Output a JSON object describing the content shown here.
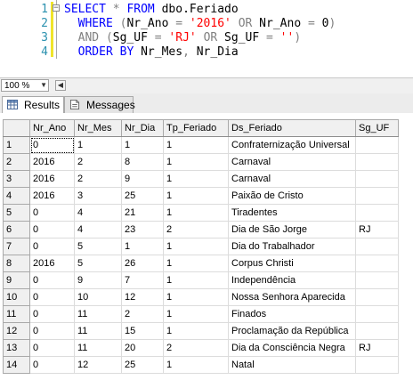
{
  "editor": {
    "lines": [
      {
        "num": "1",
        "tokens": [
          {
            "t": "SELECT",
            "c": "kw"
          },
          {
            "t": " ",
            "c": "txt"
          },
          {
            "t": "*",
            "c": "op"
          },
          {
            "t": " ",
            "c": "txt"
          },
          {
            "t": "FROM",
            "c": "kw"
          },
          {
            "t": " dbo.Feriado",
            "c": "txt"
          }
        ]
      },
      {
        "num": "2",
        "tokens": [
          {
            "t": "  WHERE",
            "c": "kw"
          },
          {
            "t": " ",
            "c": "txt"
          },
          {
            "t": "(",
            "c": "op"
          },
          {
            "t": "Nr_Ano",
            "c": "txt"
          },
          {
            "t": " = ",
            "c": "op"
          },
          {
            "t": "'2016'",
            "c": "str"
          },
          {
            "t": " ",
            "c": "txt"
          },
          {
            "t": "OR",
            "c": "op"
          },
          {
            "t": " Nr_Ano ",
            "c": "txt"
          },
          {
            "t": "=",
            "c": "op"
          },
          {
            "t": " 0",
            "c": "txt"
          },
          {
            "t": ")",
            "c": "op"
          }
        ]
      },
      {
        "num": "3",
        "tokens": [
          {
            "t": "  AND",
            "c": "op"
          },
          {
            "t": " ",
            "c": "txt"
          },
          {
            "t": "(",
            "c": "op"
          },
          {
            "t": "Sg_UF",
            "c": "txt"
          },
          {
            "t": " = ",
            "c": "op"
          },
          {
            "t": "'RJ'",
            "c": "str"
          },
          {
            "t": " ",
            "c": "txt"
          },
          {
            "t": "OR",
            "c": "op"
          },
          {
            "t": " Sg_UF ",
            "c": "txt"
          },
          {
            "t": "=",
            "c": "op"
          },
          {
            "t": " ",
            "c": "txt"
          },
          {
            "t": "''",
            "c": "str"
          },
          {
            "t": ")",
            "c": "op"
          }
        ]
      },
      {
        "num": "4",
        "tokens": [
          {
            "t": "  ORDER BY",
            "c": "kw"
          },
          {
            "t": " Nr_Mes",
            "c": "txt"
          },
          {
            "t": ",",
            "c": "op"
          },
          {
            "t": " Nr_Dia",
            "c": "txt"
          }
        ]
      }
    ]
  },
  "zoom": {
    "value": "100 %"
  },
  "tabs": {
    "results": "Results",
    "messages": "Messages"
  },
  "grid": {
    "columns": [
      "Nr_Ano",
      "Nr_Mes",
      "Nr_Dia",
      "Tp_Feriado",
      "Ds_Feriado",
      "Sg_UF"
    ],
    "rows": [
      [
        "1",
        "0",
        "1",
        "1",
        "1",
        "Confraternização Universal",
        ""
      ],
      [
        "2",
        "2016",
        "2",
        "8",
        "1",
        "Carnaval",
        ""
      ],
      [
        "3",
        "2016",
        "2",
        "9",
        "1",
        "Carnaval",
        ""
      ],
      [
        "4",
        "2016",
        "3",
        "25",
        "1",
        "Paixão de Cristo",
        ""
      ],
      [
        "5",
        "0",
        "4",
        "21",
        "1",
        "Tiradentes",
        ""
      ],
      [
        "6",
        "0",
        "4",
        "23",
        "2",
        "Dia de São Jorge",
        "RJ"
      ],
      [
        "7",
        "0",
        "5",
        "1",
        "1",
        "Dia do Trabalhador",
        ""
      ],
      [
        "8",
        "2016",
        "5",
        "26",
        "1",
        "Corpus Christi",
        ""
      ],
      [
        "9",
        "0",
        "9",
        "7",
        "1",
        "Independência",
        ""
      ],
      [
        "10",
        "0",
        "10",
        "12",
        "1",
        "Nossa Senhora Aparecida",
        ""
      ],
      [
        "11",
        "0",
        "11",
        "2",
        "1",
        "Finados",
        ""
      ],
      [
        "12",
        "0",
        "11",
        "15",
        "1",
        "Proclamação da República",
        ""
      ],
      [
        "13",
        "0",
        "11",
        "20",
        "2",
        "Dia da Consciência Negra",
        "RJ"
      ],
      [
        "14",
        "0",
        "12",
        "25",
        "1",
        "Natal",
        ""
      ]
    ]
  }
}
